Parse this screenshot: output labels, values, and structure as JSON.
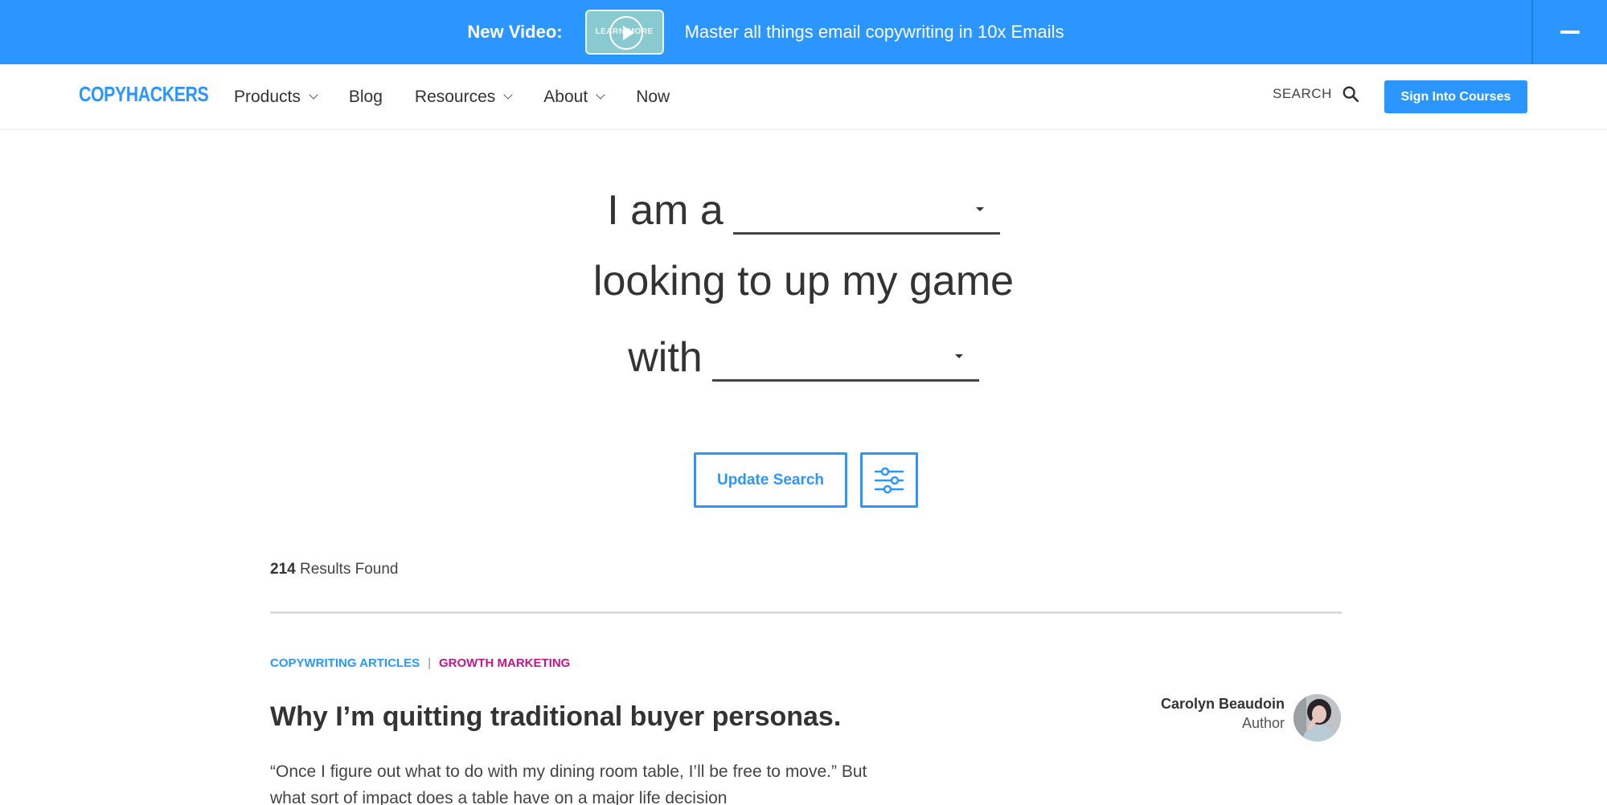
{
  "announcement": {
    "label": "New Video:",
    "thumbnail_text": "LEARN MORE",
    "text": "Master all things email copywriting in 10x Emails",
    "collapse_icon": "minus-icon",
    "background_color": "#2b96ff"
  },
  "navbar": {
    "logo": "COPYHACKERS",
    "items": [
      {
        "label": "Products",
        "has_dropdown": true
      },
      {
        "label": "Blog",
        "has_dropdown": false
      },
      {
        "label": "Resources",
        "has_dropdown": true
      },
      {
        "label": "About",
        "has_dropdown": true
      },
      {
        "label": "Now",
        "has_dropdown": false
      }
    ],
    "search_label": "SEARCH",
    "search_icon": "search-icon",
    "signin_label": "Sign Into Courses",
    "brand_color": "#2b96ff"
  },
  "hero": {
    "line1_prefix": "I am a",
    "role_select_value": "",
    "line2": "looking to up my game",
    "line3_prefix": "with",
    "topic_select_value": ""
  },
  "actions": {
    "update_label": "Update Search",
    "filter_icon": "sliders-icon"
  },
  "results": {
    "count": "214",
    "label": "Results Found"
  },
  "articles": [
    {
      "categories": [
        {
          "label": "COPYWRITING ARTICLES",
          "color": "#2b96ff"
        },
        {
          "label": "GROWTH MARKETING",
          "color": "#c0178a"
        }
      ],
      "separator": "|",
      "title": "Why I’m quitting traditional buyer personas.",
      "excerpt": "“Once I figure out what to do with my dining room table, I’ll be free to move.” But what sort of impact does a table have on a major life decision",
      "author": {
        "name": "Carolyn Beaudoin",
        "role": "Author"
      }
    }
  ]
}
